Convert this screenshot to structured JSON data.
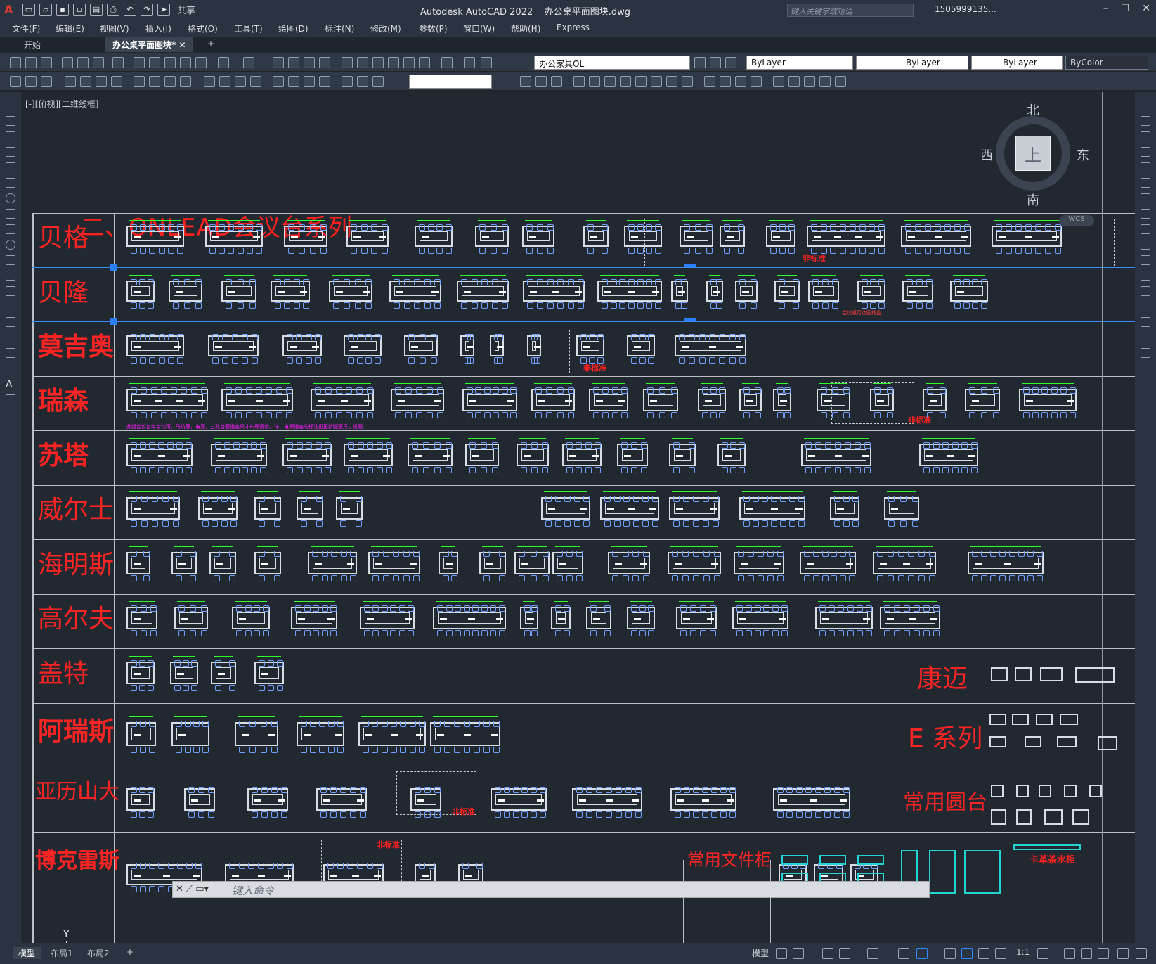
{
  "titlebar": {
    "app_logo": "A",
    "share_label": "共享",
    "title": "Autodesk AutoCAD 2022    办公桌平面图块.dwg",
    "search_placeholder": "键入关键字或短语",
    "user": "1505999135...",
    "minimize": "–",
    "maximize": "☐",
    "close": "✕"
  },
  "menubar": {
    "items": [
      "文件(F)",
      "编辑(E)",
      "视图(V)",
      "插入(I)",
      "格式(O)",
      "工具(T)",
      "绘图(D)",
      "标注(N)",
      "修改(M)",
      "参数(P)",
      "窗口(W)",
      "帮助(H)",
      "Express"
    ]
  },
  "tabs": {
    "start": "开始",
    "doc": "办公桌平面图块*",
    "close": "✕",
    "add": "+"
  },
  "toolbar": {
    "layer_value": "办公家具OL",
    "color_value": "ByLayer",
    "linetype_value": "ByLayer",
    "lineweight_value": "ByLayer",
    "plotstyle_value": "ByColor"
  },
  "canvas": {
    "view_label": "[-][俯视][二维线框]",
    "heading_prefix": "二、",
    "heading_brand": "ONLEAD",
    "heading_suffix": "会议台系列",
    "compass": {
      "n": "北",
      "s": "南",
      "e": "东",
      "w": "西",
      "top": "上"
    },
    "wcs": "WCS",
    "rows": [
      "贝格",
      "贝隆",
      "莫吉奥",
      "瑞森",
      "苏塔",
      "威尔士",
      "海明斯",
      "高尔夫",
      "盖特",
      "阿瑞斯",
      "亚历山大",
      "博克雷斯"
    ],
    "right_labels": [
      "康迈",
      "E 系列",
      "常用圆台"
    ],
    "bottom_labels": [
      "常用文件柜",
      "卡革茶水柜"
    ],
    "notes": {
      "nonstandard": "非标准",
      "nonstandard2": "非标准",
      "nonstandard3": "非标准",
      "nonstandard4": "非标准",
      "nonstandard5": "非标准",
      "pink_note": "此组会议台每台均可，马坑等，电源，三孔台面插座尺寸布局请参，详，电源插座的标注见更新配置尺寸说明",
      "pink_note2": "会议桌可选配线盒"
    },
    "axis_y": "Y"
  },
  "command": {
    "placeholder": "键入命令"
  },
  "statusbar": {
    "tabs": [
      "模型",
      "布局1",
      "布局2",
      "+"
    ],
    "model_label": "模型",
    "scale": "1:1"
  },
  "colors": {
    "background": "#212830",
    "label_red": "#ff2424",
    "dimension_green": "#2cff2c",
    "chair_blue": "#6fa0ff"
  }
}
